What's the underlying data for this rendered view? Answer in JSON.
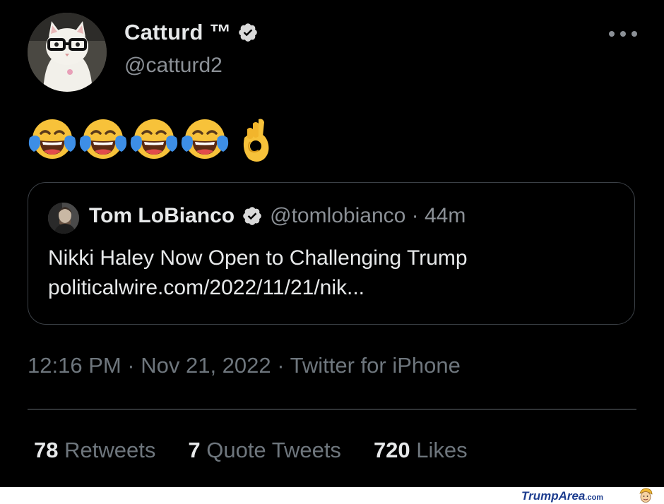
{
  "author": {
    "display_name": "Catturd ™",
    "handle": "@catturd2"
  },
  "tweet": {
    "emojis": [
      "face-with-tears-of-joy",
      "face-with-tears-of-joy",
      "face-with-tears-of-joy",
      "face-with-tears-of-joy",
      "ok-hand"
    ]
  },
  "quoted_tweet": {
    "display_name": "Tom LoBianco",
    "meta": "@tomlobianco · 44m",
    "text_line1": "Nikki Haley Now Open to Challenging Trump",
    "text_line2": "politicalwire.com/2022/11/21/nik..."
  },
  "timestamp": "12:16 PM · Nov 21, 2022 · Twitter for iPhone",
  "stats": {
    "retweets_count": "78",
    "retweets_label": "Retweets",
    "quotes_count": "7",
    "quotes_label": "Quote Tweets",
    "likes_count": "720",
    "likes_label": "Likes"
  },
  "watermark": {
    "brand": "TrumpArea",
    "suffix": ".com"
  },
  "colors": {
    "background": "#000000",
    "primary_text": "#e7e9ea",
    "secondary_text": "#8b9096",
    "verified_badge": "#d9d9d9",
    "brand": "#1d3d8f"
  }
}
